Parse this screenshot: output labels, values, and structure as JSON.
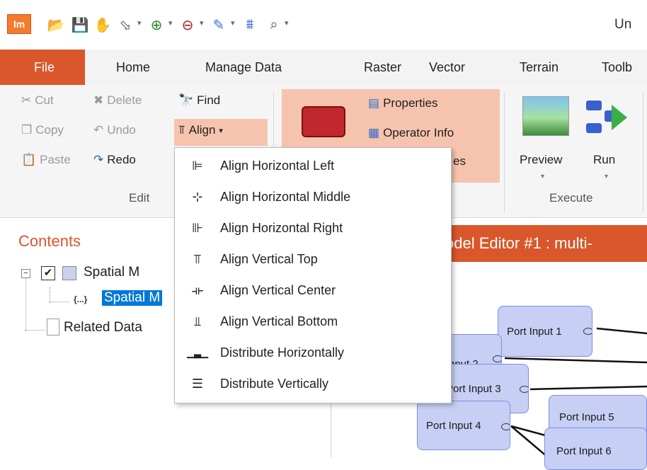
{
  "window": {
    "title": "Un"
  },
  "qat": {
    "logo": "Im"
  },
  "tabs": [
    {
      "label": "File"
    },
    {
      "label": "Home"
    },
    {
      "label": "Manage Data"
    },
    {
      "label": "Raster"
    },
    {
      "label": "Vector"
    },
    {
      "label": "Terrain"
    },
    {
      "label": "Toolb"
    }
  ],
  "ribbon": {
    "edit": {
      "cut": "Cut",
      "delete": "Delete",
      "find": "Find",
      "copy": "Copy",
      "undo": "Undo",
      "align": "Align",
      "paste": "Paste",
      "redo": "Redo",
      "label": "Edit"
    },
    "tools": {
      "properties": "Properties",
      "operator_info": "Operator Info",
      "partial": "es"
    },
    "execute": {
      "preview": "Preview",
      "run": "Run",
      "label": "Execute"
    }
  },
  "align_menu": [
    {
      "icon": "align-horizontal-left-icon",
      "glyph": "⊫",
      "label": "Align Horizontal Left"
    },
    {
      "icon": "align-horizontal-middle-icon",
      "glyph": "⊹",
      "label": "Align Horizontal Middle"
    },
    {
      "icon": "align-horizontal-right-icon",
      "glyph": "⊪",
      "label": "Align Horizontal Right"
    },
    {
      "icon": "align-vertical-top-icon",
      "glyph": "⫪",
      "label": "Align Vertical Top"
    },
    {
      "icon": "align-vertical-center-icon",
      "glyph": "⟛",
      "label": "Align Vertical Center"
    },
    {
      "icon": "align-vertical-bottom-icon",
      "glyph": "⫫",
      "label": "Align Vertical Bottom"
    },
    {
      "icon": "distribute-horizontally-icon",
      "glyph": "▁▃▁",
      "label": "Distribute Horizontally"
    },
    {
      "icon": "distribute-vertically-icon",
      "glyph": "☰",
      "label": "Distribute Vertically"
    }
  ],
  "contents": {
    "title": "Contents",
    "tree": [
      {
        "label": "Spatial M"
      },
      {
        "label": "Spatial M"
      },
      {
        "label": "Related Data"
      }
    ]
  },
  "editor": {
    "tab_title": "odel Editor #1 : multi-",
    "ports": [
      "Port Input 1",
      "nput 2",
      "Port Input 3",
      "Port Input 4",
      "Port Input 5",
      "Port Input 6"
    ]
  },
  "colors": {
    "accent": "#d9572a",
    "highlight": "#f6c4ae",
    "port_fill": "#c7cff5",
    "selection": "#0078d7"
  }
}
